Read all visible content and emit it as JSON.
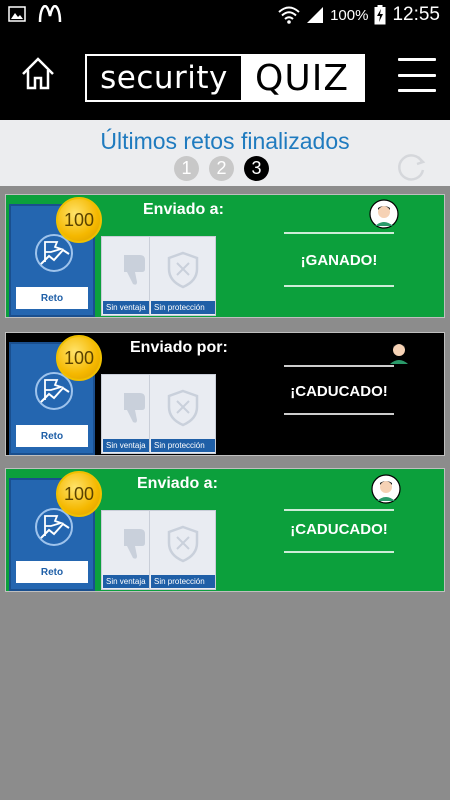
{
  "status_bar": {
    "battery": "100%",
    "time": "12:55",
    "icons": [
      "gallery-icon",
      "mcdonalds-icon",
      "wifi-icon",
      "signal-icon",
      "battery-charging-icon"
    ]
  },
  "header": {
    "logo_left": "security",
    "logo_right": "QUIZ",
    "icons": [
      "home-icon",
      "menu-icon"
    ]
  },
  "section": {
    "title": "Últimos retos finalizados",
    "pages": [
      "1",
      "2",
      "3"
    ],
    "active_page": "3"
  },
  "cards": [
    {
      "color": "#0ca03c",
      "coin": "100",
      "reto_label": "Reto",
      "tile1_label": "Sin ventaja",
      "tile2_label": "Sin protección",
      "sent_label": "Enviado a:",
      "result": "¡GANADO!"
    },
    {
      "color": "#000000",
      "coin": "100",
      "reto_label": "Reto",
      "tile1_label": "Sin ventaja",
      "tile2_label": "Sin protección",
      "sent_label": "Enviado por:",
      "result": "¡CADUCADO!"
    },
    {
      "color": "#0ca03c",
      "coin": "100",
      "reto_label": "Reto",
      "tile1_label": "Sin ventaja",
      "tile2_label": "Sin protección",
      "sent_label": "Enviado a:",
      "result": "¡CADUCADO!"
    }
  ]
}
